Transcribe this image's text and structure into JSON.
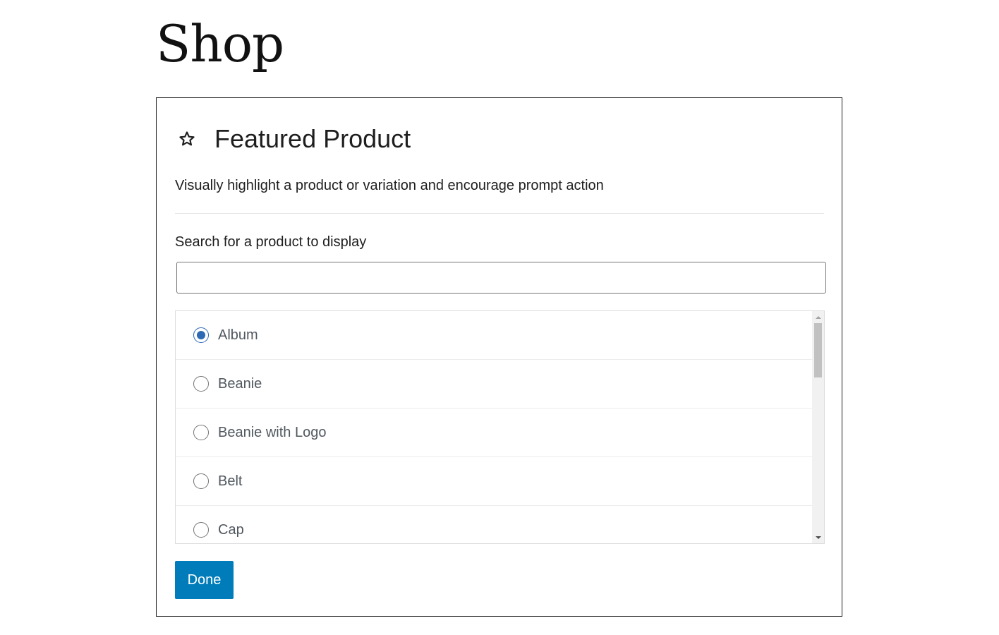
{
  "page": {
    "title": "Shop"
  },
  "block": {
    "icon": "star-icon",
    "title": "Featured Product",
    "description": "Visually highlight a product or variation and encourage prompt action",
    "search_label": "Search for a product to display",
    "search_value": "",
    "search_placeholder": "",
    "results": [
      {
        "label": "Album",
        "selected": true
      },
      {
        "label": "Beanie",
        "selected": false
      },
      {
        "label": "Beanie with Logo",
        "selected": false
      },
      {
        "label": "Belt",
        "selected": false
      },
      {
        "label": "Cap",
        "selected": false
      }
    ],
    "done_label": "Done"
  },
  "colors": {
    "accent": "#007cba",
    "radio_checked": "#2d6ab5",
    "border_dark": "#1e1e1e"
  }
}
